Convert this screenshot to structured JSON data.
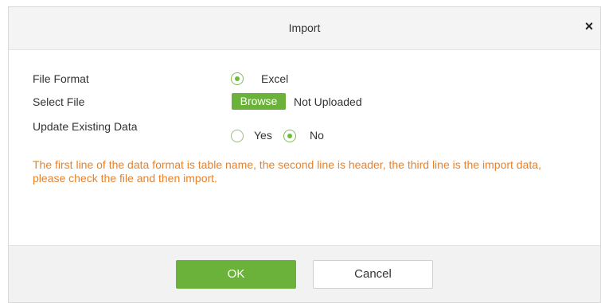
{
  "dialog": {
    "title": "Import",
    "close_label": "×"
  },
  "form": {
    "file_format": {
      "label": "File Format",
      "options": [
        {
          "label": "Excel",
          "selected": true
        }
      ]
    },
    "select_file": {
      "label": "Select File",
      "browse_label": "Browse",
      "status": "Not Uploaded"
    },
    "update_existing": {
      "label": "Update Existing Data",
      "options": [
        {
          "label": "Yes",
          "selected": false
        },
        {
          "label": "No",
          "selected": true
        }
      ]
    },
    "hint": "The first line of the data format is table name, the second line is header, the third line is the import data, please check the file and then import."
  },
  "footer": {
    "ok_label": "OK",
    "cancel_label": "Cancel"
  },
  "colors": {
    "accent": "#6ab23a",
    "hint": "#e8822a"
  }
}
